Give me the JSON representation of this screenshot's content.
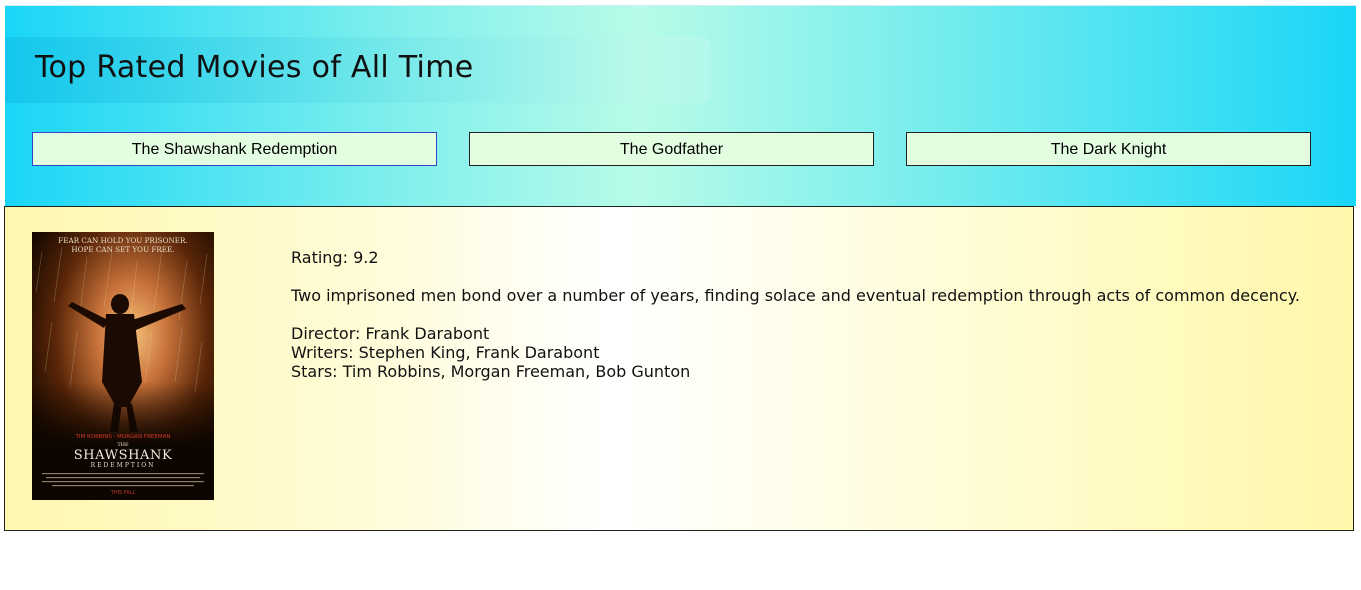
{
  "header": {
    "title": "Top Rated Movies of All Time"
  },
  "tabs": [
    {
      "label": "The Shawshank Redemption",
      "active": true
    },
    {
      "label": "The Godfather",
      "active": false
    },
    {
      "label": "The Dark Knight",
      "active": false
    }
  ],
  "movie": {
    "poster": {
      "tagline_1": "FEAR CAN HOLD YOU PRISONER.",
      "tagline_2": "HOPE CAN SET YOU FREE.",
      "actors": "TIM ROBBINS · MORGAN FREEMAN",
      "title_small": "THE",
      "title_big": "SHAWSHANK",
      "title_sub": "REDEMPTION",
      "footer": "THIS FALL"
    },
    "rating": "Rating: 9.2",
    "plot": "Two imprisoned men bond over a number of years, finding solace and eventual redemption through acts of common decency.",
    "director": "Director: Frank Darabont",
    "writers": "Writers: Stephen King, Frank Darabont",
    "stars": "Stars: Tim Robbins, Morgan Freeman, Bob Gunton"
  },
  "colors": {
    "header_gradient_edge": "#1ad6f7",
    "header_gradient_center": "#b8fbe8",
    "tab_background": "#e3fde1",
    "active_tab_border": "#3343c4",
    "content_gradient_edge": "#fff7aa"
  }
}
